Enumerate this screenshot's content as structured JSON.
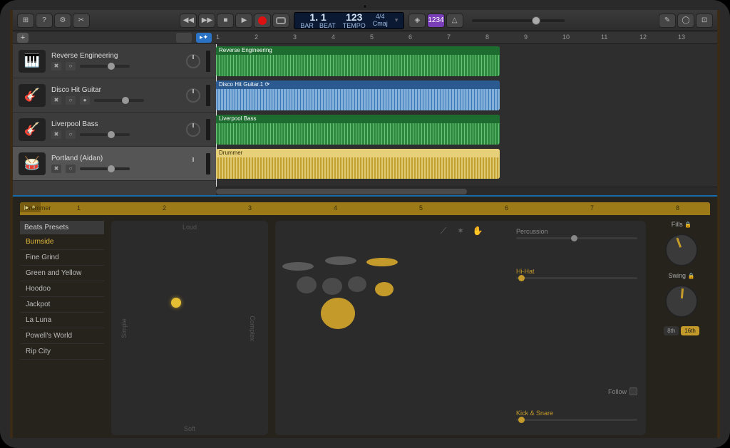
{
  "toolbar": {
    "library_icon": "⊞",
    "help_icon": "?",
    "tools_icon": "⚙",
    "scissors_icon": "✂",
    "rewind": "◀◀",
    "forward": "▶▶",
    "stop": "■",
    "play": "▶",
    "record": "●",
    "cycle": "⟳",
    "count_in": "1234",
    "metronome": "△",
    "editors_icon": "☰",
    "notepad_icon": "✎",
    "loops_icon": "◯",
    "media_icon": "⊡"
  },
  "lcd": {
    "bar_label": "BAR",
    "bar": "1",
    "beat": ". 1",
    "beat_label": "BEAT",
    "tempo": "123",
    "tempo_label": "TEMPO",
    "sig": "4/4",
    "key": "Cmaj"
  },
  "ruler": [
    "1",
    "2",
    "3",
    "4",
    "5",
    "6",
    "7",
    "8",
    "9",
    "10",
    "11",
    "12",
    "13"
  ],
  "tracks": [
    {
      "name": "Reverse Engineering",
      "icon": "🎹",
      "region": "Reverse Engineering",
      "color": "green"
    },
    {
      "name": "Disco Hit Guitar",
      "icon": "🎸",
      "region": "Disco Hit Guitar.1 ⟳",
      "color": "blue"
    },
    {
      "name": "Liverpool Bass",
      "icon": "🎸",
      "region": "Liverpool Bass",
      "color": "green"
    },
    {
      "name": "Portland (Aidan)",
      "icon": "🥁",
      "region": "Drummer",
      "color": "yellow",
      "selected": true
    }
  ],
  "editor": {
    "tab": "Drummer",
    "ruler": [
      "1",
      "2",
      "3",
      "4",
      "5",
      "6",
      "7",
      "8"
    ],
    "presets_title": "Beats Presets",
    "presets": [
      "Burnside",
      "Fine Grind",
      "Green and Yellow",
      "Hoodoo",
      "Jackpot",
      "La Luna",
      "Powell's World",
      "Rip City"
    ],
    "preset_selected": "Burnside",
    "xy": {
      "top": "Loud",
      "bottom": "Soft",
      "left": "Simple",
      "right": "Complex"
    },
    "kit": {
      "percussion": "Percussion",
      "hihat": "Hi-Hat",
      "kick": "Kick & Snare",
      "follow": "Follow"
    },
    "fills": "Fills",
    "swing": "Swing",
    "tabs": {
      "eighth": "8th",
      "sixteenth": "16th"
    }
  }
}
